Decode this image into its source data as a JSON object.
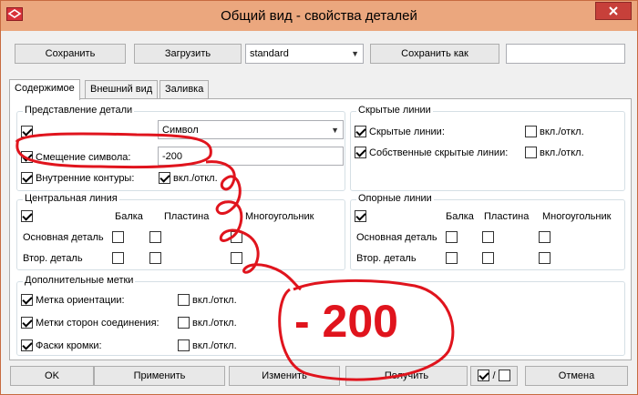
{
  "window": {
    "title": "Общий вид - свойства деталей"
  },
  "toolbar": {
    "save": "Сохранить",
    "load": "Загрузить",
    "preset": "standard",
    "save_as": "Сохранить как",
    "save_as_name": ""
  },
  "tabs": [
    "Содержимое",
    "Внешний вид",
    "Заливка"
  ],
  "representation": {
    "title": "Представление детали",
    "combo_value": "Символ",
    "offset_label": "Смещение символа:",
    "offset_value": "-200",
    "inner_label": "Внутренние контуры:",
    "inner_onoff": "вкл./откл."
  },
  "hidden_lines": {
    "title": "Скрытые линии",
    "row1": "Скрытые линии:",
    "row2": "Собственные скрытые линии:",
    "onoff": "вкл./откл."
  },
  "center_line": {
    "title": "Центральная линия",
    "cols": [
      "Балка",
      "Пластина",
      "Многоугольник"
    ],
    "rows": [
      "Основная деталь",
      "Втор. деталь"
    ]
  },
  "ref_lines": {
    "title": "Опорные линии",
    "cols": [
      "Балка",
      "Пластина",
      "Многоугольник"
    ],
    "rows": [
      "Основная деталь",
      "Втор. деталь"
    ]
  },
  "extra_marks": {
    "title": "Дополнительные метки",
    "rows": [
      "Метка ориентации:",
      "Метки сторон соединения:",
      "Фаски кромки:"
    ],
    "onoff": "вкл./откл."
  },
  "annotation": {
    "text": "- 200"
  },
  "footer": {
    "ok": "OK",
    "apply": "Применить",
    "modify": "Изменить",
    "get": "Получить",
    "toggle": "/",
    "cancel": "Отмена"
  },
  "colors": {
    "titlebar": "#eba77e",
    "annotation": "#e0141d"
  }
}
